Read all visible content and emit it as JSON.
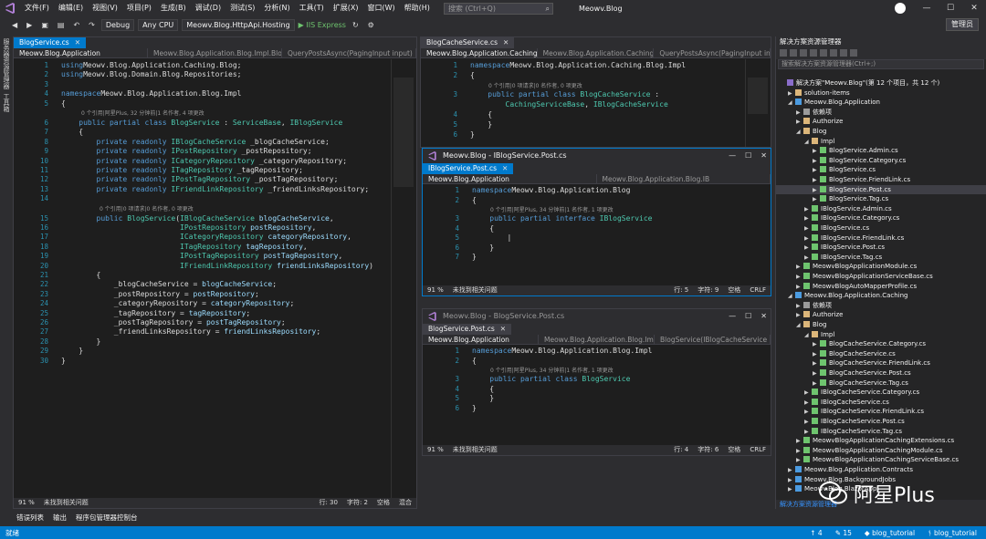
{
  "menubar": {
    "items": [
      "文件(F)",
      "编辑(E)",
      "视图(V)",
      "项目(P)",
      "生成(B)",
      "调试(D)",
      "测试(S)",
      "分析(N)",
      "工具(T)",
      "扩展(X)",
      "窗口(W)",
      "帮助(H)"
    ],
    "search_placeholder": "搜索 (Ctrl+Q)",
    "window_title": "Meowv.Blog",
    "window_controls": [
      "—",
      "☐",
      "✕"
    ]
  },
  "toolbar": {
    "config": "Debug",
    "platform": "Any CPU",
    "startup_project": "Meowv.Blog.HttpApi.Hosting",
    "run_label": "IIS Express",
    "badge_label": "管理员"
  },
  "leftstrip": {
    "items": [
      "服务器资源管理器",
      "工具箱"
    ]
  },
  "editor_main": {
    "tab_label": "BlogService.cs",
    "nav": [
      "Meowv.Blog.Application",
      "Meowv.Blog.Application.Blog.Impl.Blo",
      "QueryPostsAsync(PagingInput input)"
    ],
    "status": [
      "91 %",
      "未找到相关问题",
      "行: 30",
      "字符: 2",
      "空格",
      "混合"
    ],
    "lines": [
      {
        "n": "1",
        "parts": [
          [
            "kw",
            "using"
          ],
          [
            "",
            "Meowv.Blog.Application.Caching.Blog;"
          ]
        ]
      },
      {
        "n": "2",
        "parts": [
          [
            "kw",
            "using"
          ],
          [
            "",
            "Meowv.Blog.Domain.Blog.Repositories;"
          ]
        ]
      },
      {
        "n": "3",
        "parts": []
      },
      {
        "n": "4",
        "parts": [
          [
            "kw",
            "namespace"
          ],
          [
            "",
            "Meowv.Blog.Application.Blog.Impl"
          ]
        ]
      },
      {
        "n": "5",
        "parts": [
          [
            "",
            "{"
          ]
        ]
      },
      {
        "n": "6",
        "parts": [
          [
            "kw",
            "    public partial class"
          ],
          [
            "ty",
            " BlogService"
          ],
          [
            "",
            " : "
          ],
          [
            "ty",
            "ServiceBase"
          ],
          [
            "",
            ", "
          ],
          [
            "ty",
            "IBlogService"
          ]
        ]
      },
      {
        "n": "7",
        "parts": [
          [
            "",
            "    {"
          ]
        ]
      },
      {
        "n": "8",
        "parts": [
          [
            "kw",
            "        private readonly"
          ],
          [
            "ty",
            " IBlogCacheService"
          ],
          [
            "",
            " _blogCacheService;"
          ]
        ]
      },
      {
        "n": "9",
        "parts": [
          [
            "kw",
            "        private readonly"
          ],
          [
            "ty",
            " IPostRepository"
          ],
          [
            "",
            " _postRepository;"
          ]
        ]
      },
      {
        "n": "10",
        "parts": [
          [
            "kw",
            "        private readonly"
          ],
          [
            "ty",
            " ICategoryRepository"
          ],
          [
            "",
            " _categoryRepository;"
          ]
        ]
      },
      {
        "n": "11",
        "parts": [
          [
            "kw",
            "        private readonly"
          ],
          [
            "ty",
            " ITagRepository"
          ],
          [
            "",
            " _tagRepository;"
          ]
        ]
      },
      {
        "n": "12",
        "parts": [
          [
            "kw",
            "        private readonly"
          ],
          [
            "ty",
            " IPostTagRepository"
          ],
          [
            "",
            " _postTagRepository;"
          ]
        ]
      },
      {
        "n": "13",
        "parts": [
          [
            "kw",
            "        private readonly"
          ],
          [
            "ty",
            " IFriendLinkRepository"
          ],
          [
            "",
            " _friendLinksRepository;"
          ]
        ]
      },
      {
        "n": "14",
        "parts": []
      },
      {
        "n": "15",
        "parts": [
          [
            "kw",
            "        public"
          ],
          [
            "ty",
            " BlogService"
          ],
          [
            "",
            "("
          ],
          [
            "ty",
            "IBlogCacheService"
          ],
          [
            "pa",
            " blogCacheService"
          ],
          [
            "",
            ","
          ]
        ]
      },
      {
        "n": "16",
        "parts": [
          [
            "ty",
            "                           IPostRepository"
          ],
          [
            "pa",
            " postRepository"
          ],
          [
            "",
            ","
          ]
        ]
      },
      {
        "n": "17",
        "parts": [
          [
            "ty",
            "                           ICategoryRepository"
          ],
          [
            "pa",
            " categoryRepository"
          ],
          [
            "",
            ","
          ]
        ]
      },
      {
        "n": "18",
        "parts": [
          [
            "ty",
            "                           ITagRepository"
          ],
          [
            "pa",
            " tagRepository"
          ],
          [
            "",
            ","
          ]
        ]
      },
      {
        "n": "19",
        "parts": [
          [
            "ty",
            "                           IPostTagRepository"
          ],
          [
            "pa",
            " postTagRepository"
          ],
          [
            "",
            ","
          ]
        ]
      },
      {
        "n": "20",
        "parts": [
          [
            "ty",
            "                           IFriendLinkRepository"
          ],
          [
            "pa",
            " friendLinksRepository"
          ],
          [
            "",
            ")"
          ]
        ]
      },
      {
        "n": "21",
        "parts": [
          [
            "",
            "        {"
          ]
        ]
      },
      {
        "n": "22",
        "parts": [
          [
            "",
            "            _blogCacheService = "
          ],
          [
            "pa",
            "blogCacheService"
          ],
          [
            "",
            ";"
          ]
        ]
      },
      {
        "n": "23",
        "parts": [
          [
            "",
            "            _postRepository = "
          ],
          [
            "pa",
            "postRepository"
          ],
          [
            "",
            ";"
          ]
        ]
      },
      {
        "n": "24",
        "parts": [
          [
            "",
            "            _categoryRepository = "
          ],
          [
            "pa",
            "categoryRepository"
          ],
          [
            "",
            ";"
          ]
        ]
      },
      {
        "n": "25",
        "parts": [
          [
            "",
            "            _tagRepository = "
          ],
          [
            "pa",
            "tagRepository"
          ],
          [
            "",
            ";"
          ]
        ]
      },
      {
        "n": "26",
        "parts": [
          [
            "",
            "            _postTagRepository = "
          ],
          [
            "pa",
            "postTagRepository"
          ],
          [
            "",
            ";"
          ]
        ]
      },
      {
        "n": "27",
        "parts": [
          [
            "",
            "            _friendLinksRepository = "
          ],
          [
            "pa",
            "friendLinksRepository"
          ],
          [
            "",
            ";"
          ]
        ]
      },
      {
        "n": "28",
        "parts": [
          [
            "",
            "        }"
          ]
        ]
      },
      {
        "n": "29",
        "parts": [
          [
            "",
            "    }"
          ]
        ]
      },
      {
        "n": "30",
        "parts": [
          [
            "",
            "}"
          ]
        ]
      }
    ],
    "lens": [
      {
        "after": "5",
        "text": "0 个引用|阿星Plus, 32 分钟前|1 名作者, 4 项更改"
      },
      {
        "after": "14",
        "text": "0 个引用|0 项请求|0 名作者, 0 项更改"
      }
    ]
  },
  "editor_cache": {
    "tab_label": "BlogCacheService.cs",
    "nav": [
      "Meowv.Blog.Application.Caching",
      "Meowv.Blog.Application.Caching",
      "QueryPostsAsync(PagingInput input)"
    ],
    "lens": "0 个引用|0 项请求|0 名作者, 0 项更改",
    "lines": [
      {
        "n": "1",
        "parts": [
          [
            "kw",
            "namespace"
          ],
          [
            "",
            "Meowv.Blog.Application.Caching.Blog.Impl"
          ]
        ]
      },
      {
        "n": "2",
        "parts": [
          [
            "",
            "{"
          ]
        ]
      },
      {
        "n": "3",
        "parts": [
          [
            "kw",
            "    public partial class"
          ],
          [
            "ty",
            " BlogCacheService"
          ],
          [
            "",
            " :"
          ]
        ]
      },
      {
        "n": "",
        "parts": [
          [
            "ty",
            "        CachingServiceBase"
          ],
          [
            "",
            ", "
          ],
          [
            "ty",
            "IBlogCacheService"
          ]
        ]
      },
      {
        "n": "4",
        "parts": [
          [
            "",
            "    {"
          ]
        ]
      },
      {
        "n": "5",
        "parts": [
          [
            "",
            "    }"
          ]
        ]
      },
      {
        "n": "6",
        "parts": [
          [
            "",
            "}"
          ]
        ]
      }
    ]
  },
  "float_interface": {
    "title": "Meowv.Blog - IBlogService.Post.cs",
    "tab_label": "IBlogService.Post.cs",
    "nav": [
      "Meowv.Blog.Application",
      "Meowv.Blog.Application.Blog.IB"
    ],
    "lens": "0 个引用|阿星Plus, 34 分钟前|1 名作者, 1 项更改",
    "status": [
      "91 %",
      "未找到相关问题",
      "行: 5",
      "字符: 9",
      "空格",
      "CRLF"
    ],
    "lines": [
      {
        "n": "1",
        "parts": [
          [
            "kw",
            "namespace"
          ],
          [
            "",
            "Meowv.Blog.Application.Blog"
          ]
        ]
      },
      {
        "n": "2",
        "parts": [
          [
            "",
            "{"
          ]
        ]
      },
      {
        "n": "3",
        "parts": [
          [
            "kw",
            "    public partial interface"
          ],
          [
            "ty",
            " IBlogService"
          ]
        ]
      },
      {
        "n": "4",
        "parts": [
          [
            "",
            "    {"
          ]
        ]
      },
      {
        "n": "5",
        "parts": [
          [
            "",
            "        |"
          ]
        ]
      },
      {
        "n": "6",
        "parts": [
          [
            "",
            "    }"
          ]
        ]
      },
      {
        "n": "7",
        "parts": [
          [
            "",
            "}"
          ]
        ]
      }
    ]
  },
  "float_service": {
    "title": "Meowv.Blog - BlogService.Post.cs",
    "tab_label": "BlogService.Post.cs",
    "nav": [
      "Meowv.Blog.Application",
      "Meowv.Blog.Application.Blog.Im",
      "BlogService(IBlogCacheService b"
    ],
    "lens": "0 个引用|阿星Plus, 34 分钟前|1 名作者, 1 项更改",
    "status": [
      "91 %",
      "未找到相关问题",
      "行: 4",
      "字符: 6",
      "空格",
      "CRLF"
    ],
    "lines": [
      {
        "n": "1",
        "parts": [
          [
            "kw",
            "namespace"
          ],
          [
            "",
            "Meowv.Blog.Application.Blog.Impl"
          ]
        ]
      },
      {
        "n": "2",
        "parts": [
          [
            "",
            "{"
          ]
        ]
      },
      {
        "n": "3",
        "parts": [
          [
            "kw",
            "    public partial class"
          ],
          [
            "ty",
            " BlogService"
          ]
        ]
      },
      {
        "n": "4",
        "parts": [
          [
            "",
            "    {"
          ]
        ]
      },
      {
        "n": "5",
        "parts": [
          [
            "",
            "    }"
          ]
        ]
      },
      {
        "n": "6",
        "parts": [
          [
            "",
            "}"
          ]
        ]
      }
    ]
  },
  "solution_explorer": {
    "title": "解决方案资源管理器",
    "search_placeholder": "搜索解决方案资源管理器(Ctrl+;)",
    "bottom_tabs": "解决方案资源管理器",
    "items": [
      {
        "lvl": 0,
        "arr": "",
        "icon": "#8a6dc9",
        "label": "解决方案\"Meowv.Blog\"(第 12 个项目，共 12 个)"
      },
      {
        "lvl": 1,
        "arr": "▶",
        "icon": "#dcb67a",
        "label": "solution-items"
      },
      {
        "lvl": 1,
        "arr": "◢",
        "icon": "#4b9be0",
        "label": "Meowv.Blog.Application"
      },
      {
        "lvl": 2,
        "arr": "▶",
        "icon": "#9b9b9b",
        "label": "依赖项"
      },
      {
        "lvl": 2,
        "arr": "▶",
        "icon": "#dcb67a",
        "label": "Authorize"
      },
      {
        "lvl": 2,
        "arr": "◢",
        "icon": "#dcb67a",
        "label": "Blog"
      },
      {
        "lvl": 3,
        "arr": "◢",
        "icon": "#dcb67a",
        "label": "Impl"
      },
      {
        "lvl": 4,
        "arr": "▶",
        "icon": "#6ec46e",
        "label": "BlogService.Admin.cs"
      },
      {
        "lvl": 4,
        "arr": "▶",
        "icon": "#6ec46e",
        "label": "BlogService.Category.cs"
      },
      {
        "lvl": 4,
        "arr": "▶",
        "icon": "#6ec46e",
        "label": "BlogService.cs"
      },
      {
        "lvl": 4,
        "arr": "▶",
        "icon": "#6ec46e",
        "label": "BlogService.FriendLink.cs"
      },
      {
        "lvl": 4,
        "arr": "▶",
        "icon": "#6ec46e",
        "label": "BlogService.Post.cs",
        "sel": true
      },
      {
        "lvl": 4,
        "arr": "▶",
        "icon": "#6ec46e",
        "label": "BlogService.Tag.cs"
      },
      {
        "lvl": 3,
        "arr": "▶",
        "icon": "#6ec46e",
        "label": "IBlogService.Admin.cs"
      },
      {
        "lvl": 3,
        "arr": "▶",
        "icon": "#6ec46e",
        "label": "IBlogService.Category.cs"
      },
      {
        "lvl": 3,
        "arr": "▶",
        "icon": "#6ec46e",
        "label": "IBlogService.cs"
      },
      {
        "lvl": 3,
        "arr": "▶",
        "icon": "#6ec46e",
        "label": "IBlogService.FriendLink.cs"
      },
      {
        "lvl": 3,
        "arr": "▶",
        "icon": "#6ec46e",
        "label": "IBlogService.Post.cs"
      },
      {
        "lvl": 3,
        "arr": "▶",
        "icon": "#6ec46e",
        "label": "IBlogService.Tag.cs"
      },
      {
        "lvl": 2,
        "arr": "▶",
        "icon": "#6ec46e",
        "label": "MeowvBlogApplicationModule.cs"
      },
      {
        "lvl": 2,
        "arr": "▶",
        "icon": "#6ec46e",
        "label": "MeowvBlogApplicationServiceBase.cs"
      },
      {
        "lvl": 2,
        "arr": "▶",
        "icon": "#6ec46e",
        "label": "MeowvBlogAutoMapperProfile.cs"
      },
      {
        "lvl": 1,
        "arr": "◢",
        "icon": "#4b9be0",
        "label": "Meowv.Blog.Application.Caching"
      },
      {
        "lvl": 2,
        "arr": "▶",
        "icon": "#9b9b9b",
        "label": "依赖项"
      },
      {
        "lvl": 2,
        "arr": "▶",
        "icon": "#dcb67a",
        "label": "Authorize"
      },
      {
        "lvl": 2,
        "arr": "◢",
        "icon": "#dcb67a",
        "label": "Blog"
      },
      {
        "lvl": 3,
        "arr": "◢",
        "icon": "#dcb67a",
        "label": "Impl"
      },
      {
        "lvl": 4,
        "arr": "▶",
        "icon": "#6ec46e",
        "label": "BlogCacheService.Category.cs"
      },
      {
        "lvl": 4,
        "arr": "▶",
        "icon": "#6ec46e",
        "label": "BlogCacheService.cs"
      },
      {
        "lvl": 4,
        "arr": "▶",
        "icon": "#6ec46e",
        "label": "BlogCacheService.FriendLink.cs"
      },
      {
        "lvl": 4,
        "arr": "▶",
        "icon": "#6ec46e",
        "label": "BlogCacheService.Post.cs"
      },
      {
        "lvl": 4,
        "arr": "▶",
        "icon": "#6ec46e",
        "label": "BlogCacheService.Tag.cs"
      },
      {
        "lvl": 3,
        "arr": "▶",
        "icon": "#6ec46e",
        "label": "IBlogCacheService.Category.cs"
      },
      {
        "lvl": 3,
        "arr": "▶",
        "icon": "#6ec46e",
        "label": "IBlogCacheService.cs"
      },
      {
        "lvl": 3,
        "arr": "▶",
        "icon": "#6ec46e",
        "label": "IBlogCacheService.FriendLink.cs"
      },
      {
        "lvl": 3,
        "arr": "▶",
        "icon": "#6ec46e",
        "label": "IBlogCacheService.Post.cs"
      },
      {
        "lvl": 3,
        "arr": "▶",
        "icon": "#6ec46e",
        "label": "IBlogCacheService.Tag.cs"
      },
      {
        "lvl": 2,
        "arr": "▶",
        "icon": "#6ec46e",
        "label": "MeowvBlogApplicationCachingExtensions.cs"
      },
      {
        "lvl": 2,
        "arr": "▶",
        "icon": "#6ec46e",
        "label": "MeowvBlogApplicationCachingModule.cs"
      },
      {
        "lvl": 2,
        "arr": "▶",
        "icon": "#6ec46e",
        "label": "MeowvBlogApplicationCachingServiceBase.cs"
      },
      {
        "lvl": 1,
        "arr": "▶",
        "icon": "#4b9be0",
        "label": "Meowv.Blog.Application.Contracts"
      },
      {
        "lvl": 1,
        "arr": "▶",
        "icon": "#4b9be0",
        "label": "Meowv.Blog.BackgroundJobs"
      },
      {
        "lvl": 1,
        "arr": "▶",
        "icon": "#4b9be0",
        "label": "Meowv.Blog.BlazorApp"
      }
    ]
  },
  "output_tabs": [
    "错误列表",
    "输出",
    "程序包管理器控制台"
  ],
  "statusbar": {
    "left": "就绪",
    "right": [
      "↑ 4",
      "✎ 15",
      "◆ blog_tutorial",
      "ᚬ blog_tutorial"
    ]
  },
  "watermark": {
    "text": "阿星Plus"
  }
}
